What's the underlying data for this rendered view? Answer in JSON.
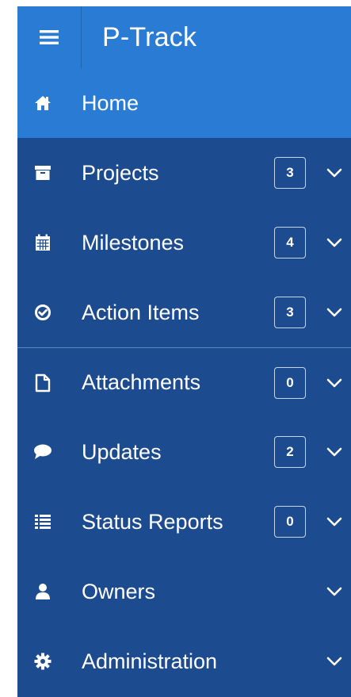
{
  "app": {
    "title": "P-Track",
    "colors": {
      "topbar": "#2a7bd4",
      "sidebar": "#1d4b8f",
      "active": "#2a7bd4",
      "text": "#ffffff"
    }
  },
  "menu": {
    "items": [
      {
        "label": "Home",
        "icon": "home-icon",
        "badge": null,
        "chevron": false,
        "active": true
      },
      {
        "label": "Projects",
        "icon": "archive-icon",
        "badge": "3",
        "chevron": true
      },
      {
        "label": "Milestones",
        "icon": "calendar-icon",
        "badge": "4",
        "chevron": true
      },
      {
        "label": "Action Items",
        "icon": "check-circle-icon",
        "badge": "3",
        "chevron": true
      },
      {
        "label": "Attachments",
        "icon": "file-icon",
        "badge": "0",
        "chevron": true
      },
      {
        "label": "Updates",
        "icon": "comment-icon",
        "badge": "2",
        "chevron": true
      },
      {
        "label": "Status Reports",
        "icon": "list-icon",
        "badge": "0",
        "chevron": true
      },
      {
        "label": "Owners",
        "icon": "user-icon",
        "badge": null,
        "chevron": true
      },
      {
        "label": "Administration",
        "icon": "gear-icon",
        "badge": null,
        "chevron": true
      }
    ]
  }
}
